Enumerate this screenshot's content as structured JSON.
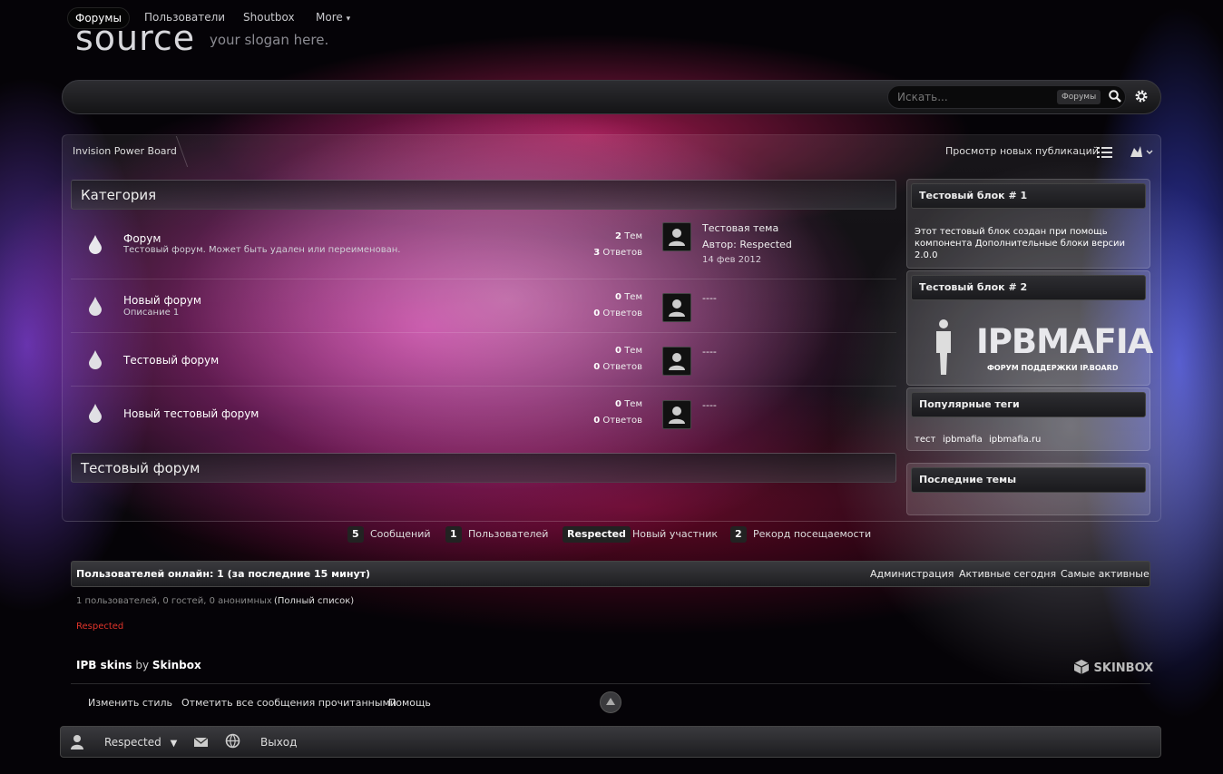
{
  "header": {
    "logo": "source",
    "slogan": "your slogan here."
  },
  "nav": {
    "items": [
      {
        "label": "Форумы",
        "active": true
      },
      {
        "label": "Пользователи"
      },
      {
        "label": "Shoutbox"
      },
      {
        "label": "More"
      }
    ],
    "search": {
      "placeholder": "Искать...",
      "scope": "Форумы"
    }
  },
  "breadcrumb": {
    "home": "Invision Power Board",
    "new_posts": "Просмотр новых публикаций"
  },
  "categories": [
    {
      "title": "Категория",
      "forums": [
        {
          "name": "Форум",
          "description": "Тестовый форум. Может быть удален или переименован.",
          "topics": "2",
          "topics_label": "Тем",
          "replies": "3",
          "replies_label": "Ответов",
          "last_title": "Тестовая тема",
          "last_author": "Автор: Respected",
          "last_date": "14 фев 2012"
        },
        {
          "name": "Новый форум",
          "description": "Описание 1",
          "topics": "0",
          "topics_label": "Тем",
          "replies": "0",
          "replies_label": "Ответов",
          "last_title": "----"
        },
        {
          "name": "Тестовый форум",
          "description": "",
          "topics": "0",
          "topics_label": "Тем",
          "replies": "0",
          "replies_label": "Ответов",
          "last_title": "----"
        },
        {
          "name": "Новый тестовый форум",
          "description": "",
          "topics": "0",
          "topics_label": "Тем",
          "replies": "0",
          "replies_label": "Ответов",
          "last_title": "----"
        }
      ]
    },
    {
      "title": "Тестовый форум"
    }
  ],
  "sidebar": {
    "block1": {
      "title": "Тестовый блок # 1",
      "text": [
        "Этот тестовый блок создан при помощь",
        "компонента Дополнительные блоки версии",
        "2.0.0"
      ]
    },
    "block2": {
      "title": "Тестовый блок # 2",
      "logo_text": "IPBMAFIA",
      "logo_sub": "ФОРУМ ПОДДЕРЖКИ IP.BOARD"
    },
    "tags": {
      "title": "Популярные теги",
      "items": [
        "тест",
        "ipbmafia",
        "ipbmafia.ru"
      ]
    },
    "latest": {
      "title": "Последние темы"
    }
  },
  "stats": [
    {
      "value": "5",
      "label": "Сообщений"
    },
    {
      "value": "1",
      "label": "Пользователей"
    },
    {
      "value": "Respected",
      "label": "Новый участник"
    },
    {
      "value": "2",
      "label": "Рекорд посещаемости"
    }
  ],
  "online": {
    "title": "Пользователей онлайн: 1 (за последние 15 минут)",
    "links": [
      "Администрация",
      "Активные сегодня",
      "Самые активные"
    ],
    "info": "1 пользователей, 0 гостей, 0 анонимных",
    "full_list": "(Полный список)",
    "users": "Respected",
    "user_color": "#e0342a"
  },
  "footer": {
    "credit_a": "IPB skins",
    "credit_by": "by",
    "credit_b": "Skinbox",
    "skinbox": "SKINBOX",
    "links": [
      "Изменить стиль",
      "Отметить все сообщения прочитанными",
      "Помощь"
    ]
  },
  "userbar": {
    "username": "Respected",
    "logout": "Выход"
  }
}
